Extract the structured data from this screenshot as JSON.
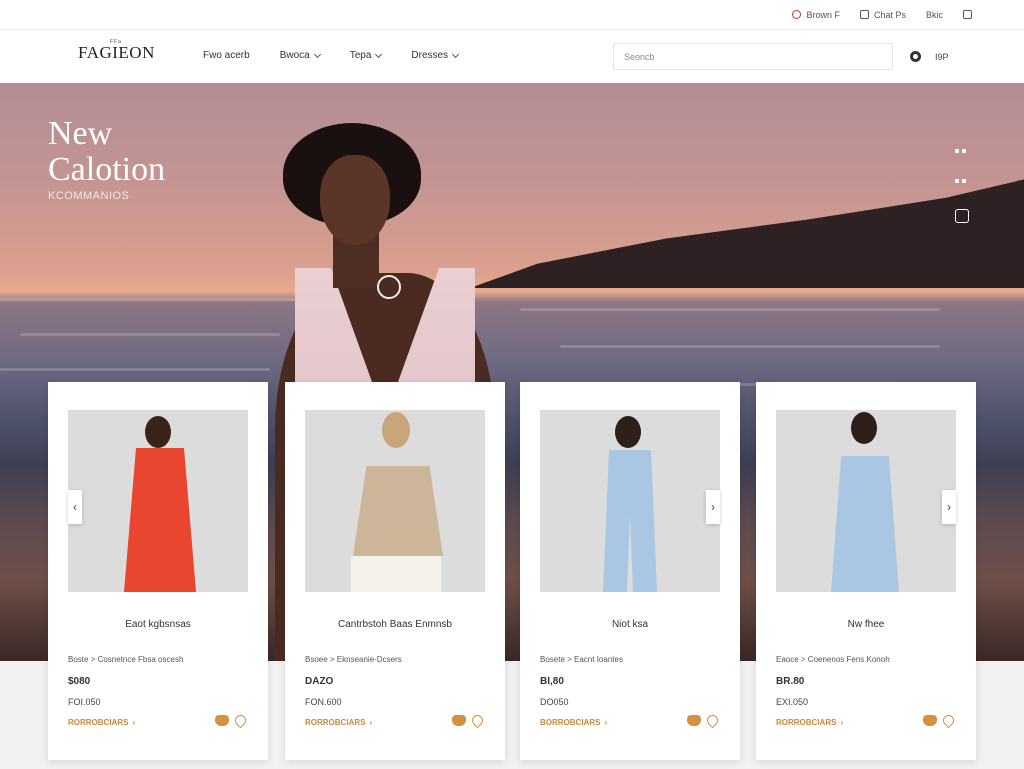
{
  "utility": {
    "items": [
      {
        "label": "Brown F",
        "icon": "location-icon"
      },
      {
        "label": "Chat Ps",
        "icon": "chat-icon"
      },
      {
        "label": "Bkic",
        "icon": "user-icon"
      }
    ]
  },
  "header": {
    "logo": "FAGIEON",
    "logo_small": "FFa",
    "nav": [
      "Fwo acerb",
      "Bwoca",
      "Tepa",
      "Dresses"
    ],
    "search_placeholder": "Seoncb",
    "account_label": "I9P"
  },
  "hero": {
    "title_line1": "New",
    "title_line2": "Calotion",
    "subtitle": "KCOMMANIOS"
  },
  "products": [
    {
      "name": "Eaot kgbsnsas",
      "crumb": "Boste > Cosnetnce Fbsa oscesh",
      "price": "$080",
      "price2": "FOI.050",
      "cart": "RORROBCIARS"
    },
    {
      "name": "Cantrbstoh Baas Enmnsb",
      "crumb": "Bsoee > Eknseanie-Dcsers",
      "price": "DAZO",
      "price2": "FON.600",
      "cart": "RORROBCIARS"
    },
    {
      "name": "Niot ksa",
      "crumb": "Bosete > Eacnt Ioantes",
      "price": "BI,80",
      "price2": "DO050",
      "cart": "BORROBCIARS"
    },
    {
      "name": "Nw fhee",
      "crumb": "Eaoce > Coenenos Fens Konoh",
      "price": "BR.80",
      "price2": "EXI.050",
      "cart": "RORROBCIARS"
    }
  ],
  "colors": {
    "accent": "#d4913e",
    "text": "#222222",
    "card_bg": "#ffffff"
  }
}
